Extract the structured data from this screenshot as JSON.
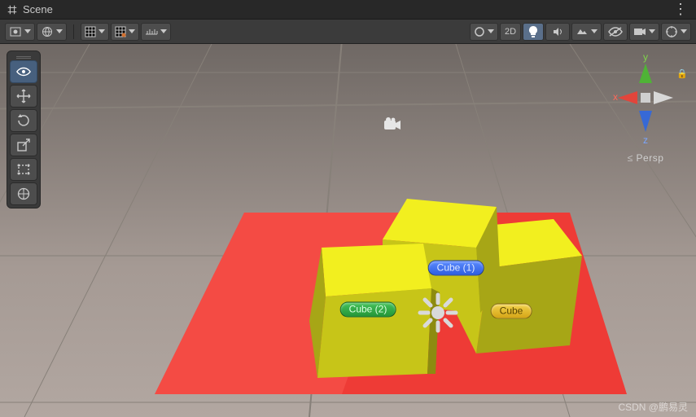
{
  "tab": {
    "title": "Scene"
  },
  "toolbar": {
    "mode2d_label": "2D",
    "lighting_on": true
  },
  "gizmo": {
    "axes": {
      "x": "x",
      "y": "y",
      "z": "z"
    },
    "projection": "Persp"
  },
  "tool_palette": {
    "active_index": 0,
    "tools": [
      "view-tool",
      "move-tool",
      "rotate-tool",
      "scale-tool",
      "rect-tool",
      "transform-tool"
    ]
  },
  "scene": {
    "objects": [
      {
        "name": "Cube (1)",
        "color": "blue",
        "pos": [
          560,
          275
        ]
      },
      {
        "name": "Cube (2)",
        "color": "green",
        "pos": [
          452,
          326
        ]
      },
      {
        "name": "Cube",
        "color": "yellow",
        "pos": [
          628,
          328
        ]
      }
    ]
  },
  "watermark": "CSDN @鹏易灵"
}
